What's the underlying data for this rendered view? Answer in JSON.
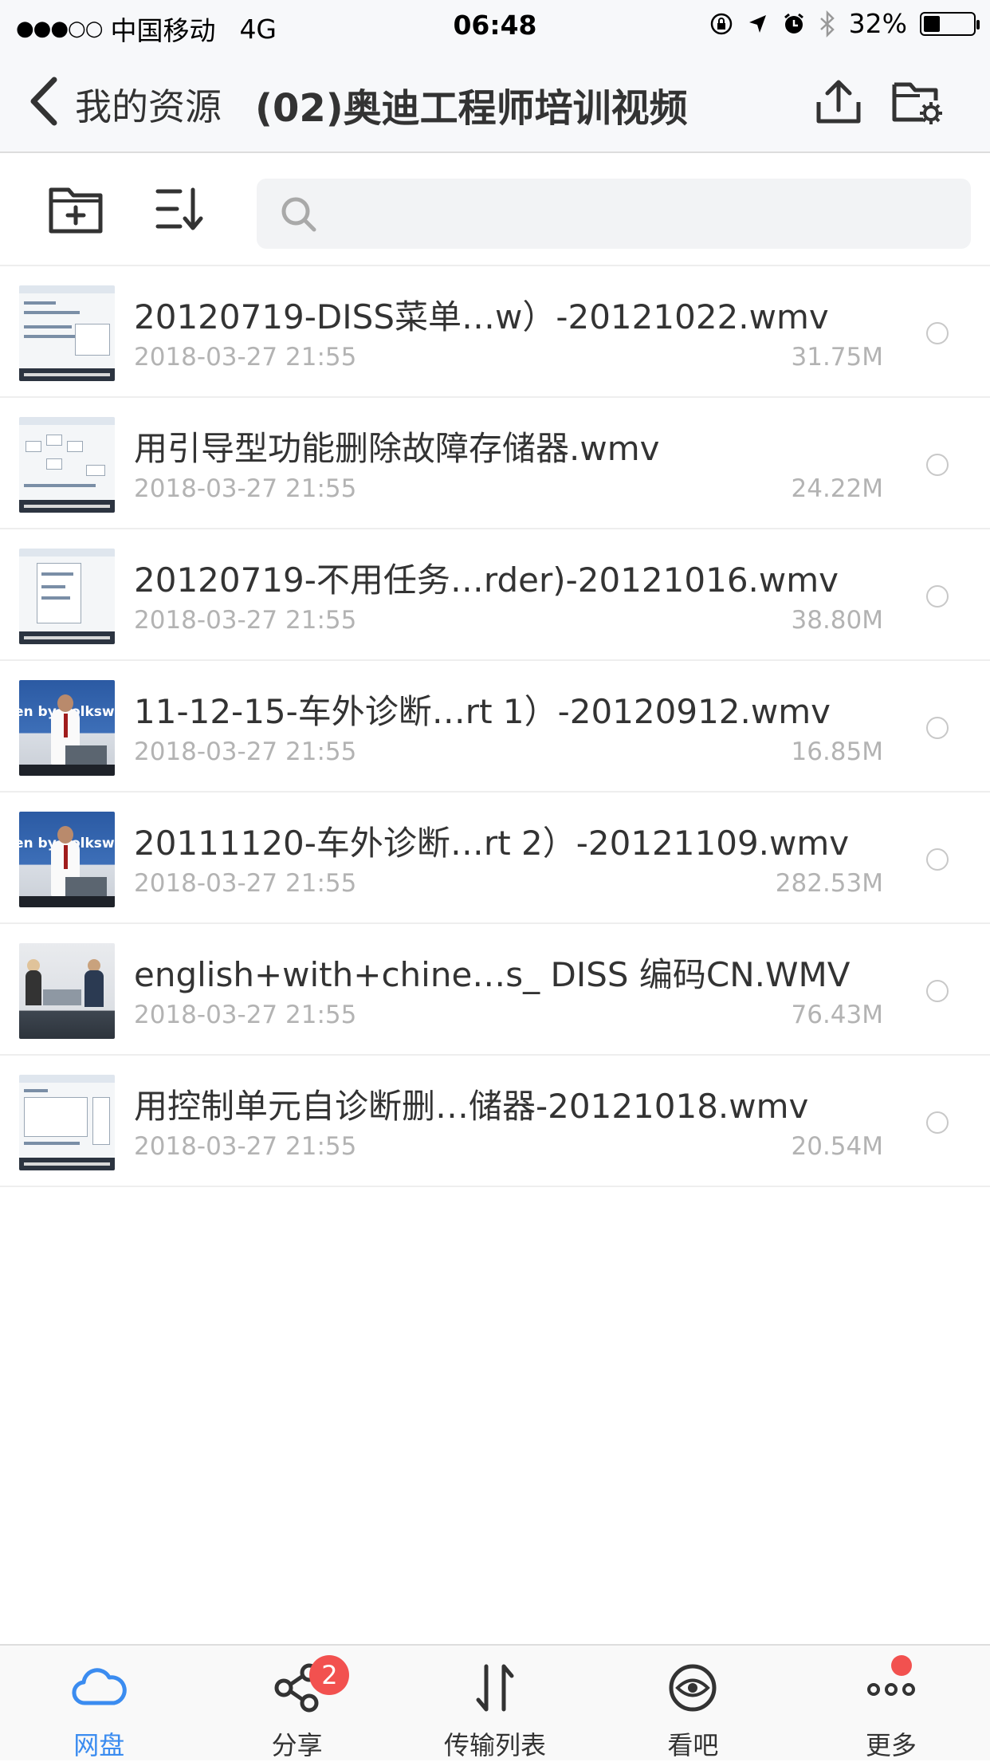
{
  "status_bar": {
    "signal": "●●●○○",
    "carrier": "中国移动",
    "network": "4G",
    "time": "06:48",
    "battery_percent": "32%",
    "battery_level": 0.32
  },
  "nav": {
    "back_label": "我的资源",
    "title": "(02)奥迪工程师培训视频"
  },
  "search": {
    "placeholder": "",
    "value": ""
  },
  "files": [
    {
      "name": "20120719-DISS菜单…w）-20121022.wmv",
      "date": "2018-03-27 21:55",
      "size": "31.75M"
    },
    {
      "name": "用引导型功能删除故障存储器.wmv",
      "date": "2018-03-27 21:55",
      "size": "24.22M"
    },
    {
      "name": "20120719-不用任务…rder)-20121016.wmv",
      "date": "2018-03-27 21:55",
      "size": "38.80M"
    },
    {
      "name": "11-12-15-车外诊断…rt 1）-20120912.wmv",
      "date": "2018-03-27 21:55",
      "size": "16.85M"
    },
    {
      "name": "20111120-车外诊断…rt 2）-20121109.wmv",
      "date": "2018-03-27 21:55",
      "size": "282.53M"
    },
    {
      "name": "english+with+chine…s_ DISS 编码CN.WMV",
      "date": "2018-03-27 21:55",
      "size": "76.43M"
    },
    {
      "name": "用控制单元自诊断删…储器-20121018.wmv",
      "date": "2018-03-27 21:55",
      "size": "20.54M"
    }
  ],
  "thumbnails": {
    "vw_text": "en by Volksw"
  },
  "tabs": [
    {
      "label": "网盘",
      "icon": "cloud-icon",
      "active": true
    },
    {
      "label": "分享",
      "icon": "share-icon",
      "badge": "2"
    },
    {
      "label": "传输列表",
      "icon": "transfer-icon"
    },
    {
      "label": "看吧",
      "icon": "eye-icon"
    },
    {
      "label": "更多",
      "icon": "more-icon",
      "dot": true
    }
  ],
  "colors": {
    "accent": "#3b8cf0",
    "badge": "#f2514f",
    "secondary_text": "#b3b3b3"
  }
}
